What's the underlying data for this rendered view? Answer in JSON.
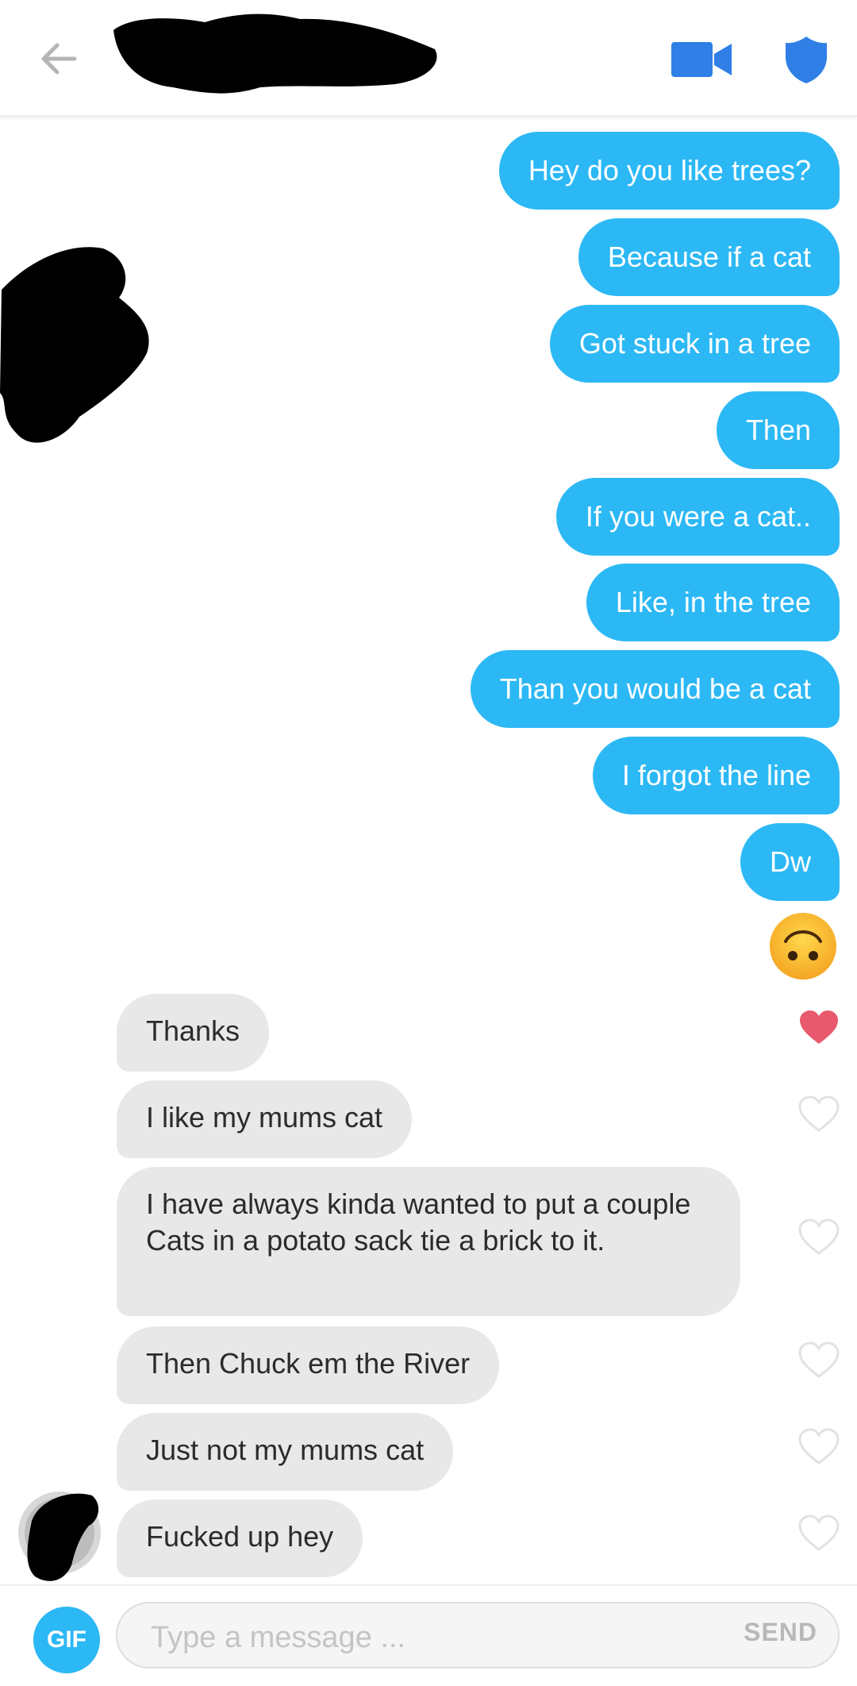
{
  "header": {
    "back_icon": "arrow-left-icon",
    "video_icon": "video-camera-icon",
    "safety_icon": "shield-icon",
    "accent": "#2cb8f5"
  },
  "messages": [
    {
      "from": "me",
      "text": "Hey do you like trees?"
    },
    {
      "from": "me",
      "text": "Because if a cat"
    },
    {
      "from": "me",
      "text": "Got stuck in a tree"
    },
    {
      "from": "me",
      "text": "Then"
    },
    {
      "from": "me",
      "text": "If you were a cat.."
    },
    {
      "from": "me",
      "text": "Like, in the tree"
    },
    {
      "from": "me",
      "text": "Than you would be a cat"
    },
    {
      "from": "me",
      "text": "I forgot the line"
    },
    {
      "from": "me",
      "text": "Dw"
    },
    {
      "from": "me",
      "emoji": "upside-down-face"
    },
    {
      "from": "them",
      "text": "Thanks",
      "liked": true
    },
    {
      "from": "them",
      "text": "I like my mums cat",
      "liked": false
    },
    {
      "from": "them",
      "text": "I have always kinda wanted to put a couple Cats in a potato sack tie a brick to it.",
      "liked": false
    },
    {
      "from": "them",
      "text": "Then Chuck em the River",
      "liked": false
    },
    {
      "from": "them",
      "text": "Just not my mums cat",
      "liked": false
    },
    {
      "from": "them",
      "text": "Fucked up hey",
      "liked": false
    }
  ],
  "composer": {
    "gif_label": "GIF",
    "placeholder": "Type a message ...",
    "value": "",
    "send_label": "SEND"
  },
  "colors": {
    "outgoing_bubble": "#2cb8f5",
    "incoming_bubble": "#e8e8e8",
    "heart_liked": "#e8596d",
    "heart_unliked": "#e2e2e2"
  }
}
